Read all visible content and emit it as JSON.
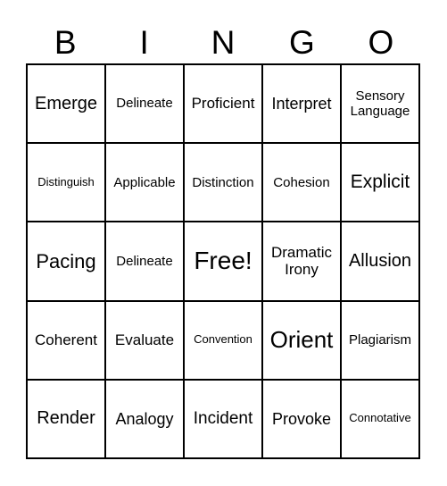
{
  "header": [
    "B",
    "I",
    "N",
    "G",
    "O"
  ],
  "cells": [
    [
      "Emerge",
      20
    ],
    [
      "Delineate",
      15
    ],
    [
      "Proficient",
      17
    ],
    [
      "Interpret",
      18
    ],
    [
      "Sensory Language",
      15
    ],
    [
      "Distinguish",
      13
    ],
    [
      "Applicable",
      15
    ],
    [
      "Distinction",
      15
    ],
    [
      "Cohesion",
      15
    ],
    [
      "Explicit",
      21
    ],
    [
      "Pacing",
      22
    ],
    [
      "Delineate",
      15
    ],
    [
      "Free!",
      28
    ],
    [
      "Dramatic Irony",
      17
    ],
    [
      "Allusion",
      20
    ],
    [
      "Coherent",
      17
    ],
    [
      "Evaluate",
      17
    ],
    [
      "Convention",
      13
    ],
    [
      "Orient",
      26
    ],
    [
      "Plagiarism",
      15
    ],
    [
      "Render",
      20
    ],
    [
      "Analogy",
      18
    ],
    [
      "Incident",
      19
    ],
    [
      "Provoke",
      18
    ],
    [
      "Connotative",
      13
    ]
  ]
}
